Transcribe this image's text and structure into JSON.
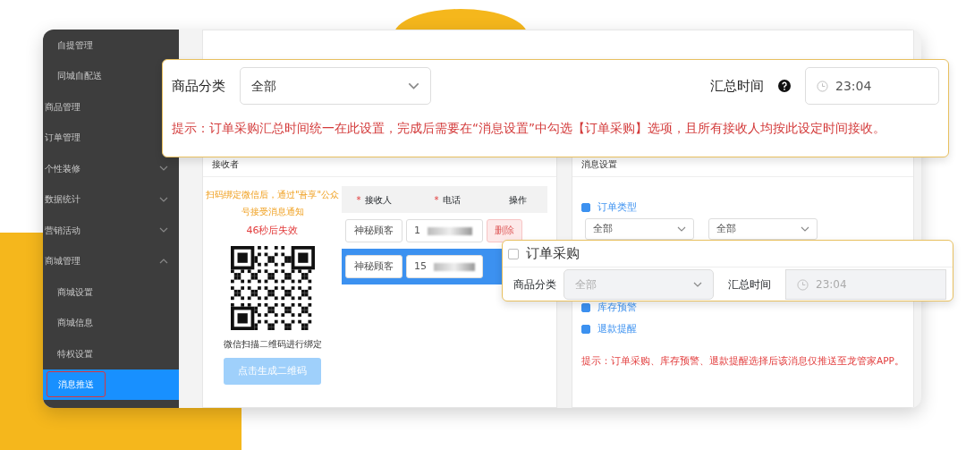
{
  "sidebar": {
    "items": [
      {
        "children": [
          {
            "label": "自提管理",
            "selected": false
          },
          {
            "label": "同城自配送",
            "selected": false
          }
        ]
      },
      {
        "label": "商品管理",
        "selected": false
      },
      {
        "label": "订单管理",
        "selected": false
      },
      {
        "label": "个性装修",
        "selected": false,
        "expanded": false
      },
      {
        "label": "数据统计",
        "selected": false,
        "expanded": false
      },
      {
        "label": "营销活动",
        "selected": false,
        "expanded": false
      },
      {
        "label": "商城管理",
        "selected": false,
        "expanded": true,
        "children": [
          {
            "label": "商城设置",
            "selected": false
          },
          {
            "label": "商城信息",
            "selected": false
          },
          {
            "label": "特权设置",
            "selected": false
          },
          {
            "label": "消息推送",
            "selected": true,
            "annotated": true
          }
        ]
      }
    ]
  },
  "receiver_panel": {
    "title": "接收者",
    "scan_note": "扫码绑定微信后，通过\"吾享\"公众号接受消息通知",
    "countdown": "46秒后失效",
    "qr_caption": "微信扫描二维码进行绑定",
    "generate_button": "点击生成二维码",
    "columns": [
      {
        "label": "接收人",
        "required_mark": "*"
      },
      {
        "label": "电话",
        "required_mark": "*"
      },
      {
        "label": "操作"
      }
    ],
    "rows": [
      {
        "name": "神秘顾客",
        "phone": "1",
        "action": "删除",
        "selected": false
      },
      {
        "name": "神秘顾客",
        "phone": "15",
        "selected": true
      }
    ]
  },
  "message_panel": {
    "title": "消息设置",
    "options": [
      {
        "label": "订单类型",
        "checked": true,
        "selects": [
          "全部",
          "全部"
        ]
      },
      {
        "label": "库存预警",
        "checked": true
      },
      {
        "label": "退款提醒",
        "checked": true
      }
    ],
    "hint": "提示：订单采购、库存预警、退款提醒选择后该消息仅推送至龙管家APP。"
  },
  "callout_summary": {
    "category_label": "商品分类",
    "category_value": "全部",
    "time_label": "汇总时间",
    "time_value": "23:04",
    "hint": "提示：订单采购汇总时间统一在此设置，完成后需要在“消息设置”中勾选【订单采购】选项，且所有接收人均按此设定时间接收。"
  },
  "callout_purchase": {
    "title": "订单采购",
    "checked": false,
    "category_label": "商品分类",
    "category_value": "全部",
    "disabled": true,
    "time_label": "汇总时间",
    "time_value": "23:04"
  }
}
